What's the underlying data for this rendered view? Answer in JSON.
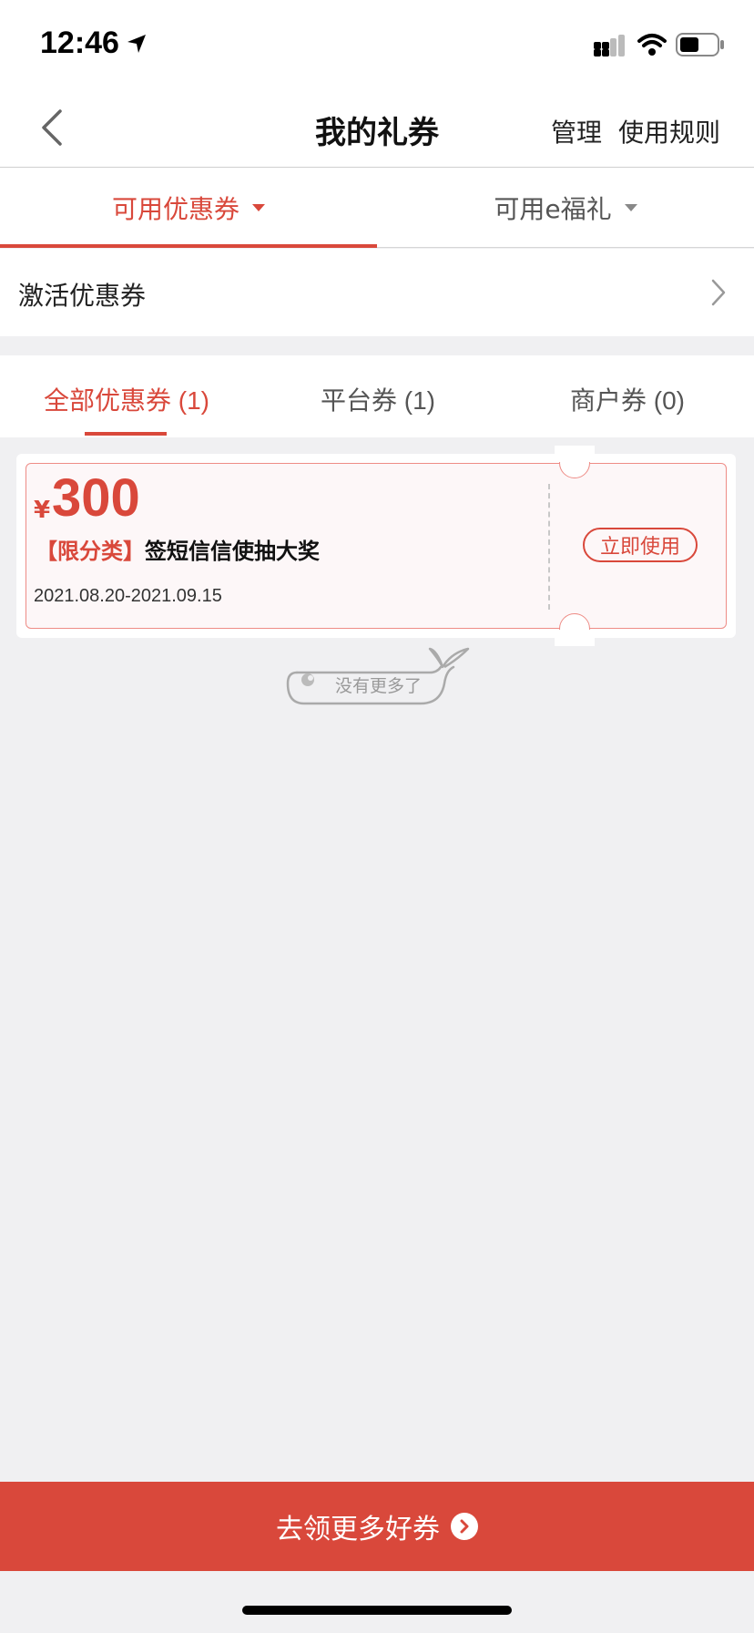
{
  "status_bar": {
    "time": "12:46",
    "icons": [
      "location-arrow-icon",
      "cellular-signal-icon",
      "wifi-icon",
      "battery-icon"
    ]
  },
  "nav": {
    "title": "我的礼券",
    "manage_label": "管理",
    "rules_label": "使用规则",
    "back_icon": "chevron-left-icon"
  },
  "main_tabs": [
    {
      "label": "可用优惠券",
      "active": true
    },
    {
      "label": "可用e福礼",
      "active": false
    }
  ],
  "activate_row": {
    "label": "激活优惠券"
  },
  "sub_tabs": [
    {
      "label": "全部优惠券 (1)",
      "active": true
    },
    {
      "label": "平台券 (1)",
      "active": false
    },
    {
      "label": "商户券 (0)",
      "active": false
    }
  ],
  "coupon": {
    "currency": "¥",
    "amount": "300",
    "tag": "【限分类】",
    "name": "签短信信使抽大奖",
    "date_range": "2021.08.20-2021.09.15",
    "use_label": "立即使用"
  },
  "no_more_text": "没有更多了",
  "bottom_button": {
    "label": "去领更多好券"
  },
  "colors": {
    "accent": "#d9483b",
    "background": "#f0f0f2"
  }
}
